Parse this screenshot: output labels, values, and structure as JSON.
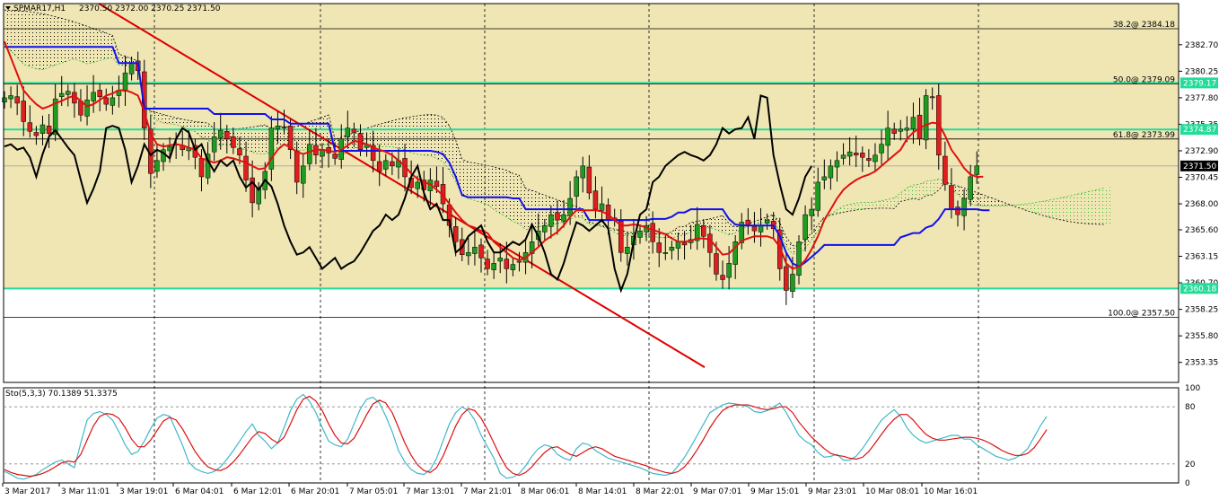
{
  "header": {
    "symbol": "SPMAR17,H1",
    "ohlc": "2370.50 2372.00 2370.25 2371.50"
  },
  "colors": {
    "background": "#ffffff",
    "band": "#efe6b4",
    "bull": "#1f9c1f",
    "bear": "#dd1f1f",
    "tenkan": "#e01010",
    "kijun": "#1010ee",
    "chikou": "#000000",
    "level_line": "#22dd99",
    "trend_line": "#dd0000",
    "sto_main": "#40b8c8",
    "sto_signal": "#dd1010"
  },
  "indicator": {
    "label": "Sto(5,3,3) 70.1389 51.3375"
  },
  "chart_data": [
    {
      "type": "candlestick",
      "title": "SPMAR17,H1",
      "ylim": [
        2351.5,
        2386.5
      ],
      "y_ticks": [
        "2382.70",
        "2380.25",
        "2377.80",
        "2375.35",
        "2372.90",
        "2370.45",
        "2368.00",
        "2365.60",
        "2363.15",
        "2360.70",
        "2358.25",
        "2355.80",
        "2353.35"
      ],
      "x_ticks": [
        "3 Mar 2017",
        "3 Mar 11:01",
        "3 Mar 19:01",
        "6 Mar 04:01",
        "6 Mar 12:01",
        "6 Mar 20:01",
        "7 Mar 05:01",
        "7 Mar 13:01",
        "7 Mar 21:01",
        "8 Mar 06:01",
        "8 Mar 14:01",
        "8 Mar 22:01",
        "9 Mar 07:01",
        "9 Mar 15:01",
        "9 Mar 23:01",
        "10 Mar 08:01",
        "10 Mar 16:01"
      ],
      "level_lines": [
        {
          "label": "2379.17",
          "value": 2379.17
        },
        {
          "label": "2374.87",
          "value": 2374.87
        },
        {
          "label": "2360.18",
          "value": 2360.18
        }
      ],
      "fibonacci": [
        {
          "label": "38.2@ 2384.18",
          "value": 2384.18
        },
        {
          "label": "50.0@ 2379.09",
          "value": 2379.09
        },
        {
          "label": "61.8@ 2373.99",
          "value": 2373.99
        },
        {
          "label": "100.0@ 2357.50",
          "value": 2357.5
        }
      ],
      "current_price": {
        "label": "2371.50",
        "value": 2371.5
      },
      "candles_close": [
        2377.8,
        2378.0,
        2377.3,
        2375.6,
        2374.7,
        2374.3,
        2375.3,
        2374.5,
        2377.7,
        2378.2,
        2378.4,
        2377.3,
        2376.2,
        2377.6,
        2378.3,
        2377.9,
        2377.2,
        2377.8,
        2378.5,
        2380.1,
        2381.0,
        2380.3,
        2375.0,
        2370.8,
        2372.0,
        2373.0,
        2373.3,
        2373.5,
        2373.0,
        2373.2,
        2372.3,
        2370.5,
        2372.6,
        2374.2,
        2374.8,
        2374.0,
        2373.2,
        2372.5,
        2370.2,
        2368.1,
        2369.4,
        2371.0,
        2375.0,
        2375.2,
        2375.0,
        2373.0,
        2370.0,
        2371.5,
        2373.5,
        2372.5,
        2373.0,
        2372.7,
        2372.2,
        2374.0,
        2375.0,
        2374.6,
        2373.0,
        2373.5,
        2372.0,
        2371.0,
        2372.0,
        2371.5,
        2372.0,
        2370.5,
        2369.5,
        2370.0,
        2369.3,
        2370.2,
        2369.6,
        2368.0,
        2366.0,
        2364.5,
        2363.3,
        2363.5,
        2364.0,
        2363.0,
        2362.0,
        2362.5,
        2363.0,
        2362.0,
        2362.4,
        2362.7,
        2363.5,
        2364.5,
        2365.5,
        2366.0,
        2367.0,
        2366.5,
        2367.0,
        2368.5,
        2370.5,
        2371.5,
        2369.0,
        2367.5,
        2368.0,
        2366.5,
        2366.5,
        2363.5,
        2364.0,
        2365.0,
        2365.5,
        2366.0,
        2364.5,
        2363.5,
        2363.5,
        2364.0,
        2364.5,
        2364.2,
        2364.7,
        2366.1,
        2365.0,
        2363.5,
        2361.5,
        2361.0,
        2362.5,
        2364.5,
        2366.3,
        2366.0,
        2365.5,
        2366.0,
        2366.5,
        2365.7,
        2362.0,
        2360.0,
        2361.5,
        2364.5,
        2367.0,
        2367.5,
        2370.0,
        2370.5,
        2371.5,
        2372.0,
        2372.5,
        2372.8,
        2372.5,
        2372.3,
        2372.0,
        2372.5,
        2373.5,
        2375.0,
        2374.5,
        2374.9,
        2375.0,
        2376.0,
        2374.0,
        2378.0,
        2377.8,
        2372.5,
        2369.8,
        2367.5,
        2367.0,
        2368.5,
        2370.5,
        2371.5
      ],
      "tenkan": [
        2383.0,
        2381.5,
        2380.0,
        2378.5,
        2377.8,
        2377.2,
        2376.8,
        2377.0,
        2377.3,
        2377.5,
        2377.8,
        2378.0,
        2377.5,
        2377.0,
        2377.2,
        2377.6,
        2378.0,
        2378.2,
        2378.5,
        2378.5,
        2378.3,
        2378.0,
        2376.5,
        2374.5,
        2373.5,
        2373.3,
        2373.4,
        2373.5,
        2373.4,
        2373.2,
        2373.0,
        2372.2,
        2372.0,
        2371.8,
        2372.0,
        2372.3,
        2372.2,
        2372.0,
        2371.8,
        2371.5,
        2371.2,
        2371.3,
        2372.2,
        2373.0,
        2373.5,
        2373.2,
        2372.8,
        2372.6,
        2372.8,
        2373.0,
        2373.0,
        2372.9,
        2372.8,
        2373.0,
        2373.4,
        2373.8,
        2373.7,
        2373.5,
        2373.2,
        2373.0,
        2372.8,
        2372.5,
        2372.0,
        2371.5,
        2370.8,
        2370.3,
        2370.0,
        2369.8,
        2369.3,
        2368.8,
        2368.0,
        2367.2,
        2366.5,
        2366.0,
        2365.8,
        2365.5,
        2365.3,
        2364.5,
        2364.0,
        2363.5,
        2363.0,
        2362.8,
        2363.0,
        2363.5,
        2364.0,
        2364.6,
        2365.0,
        2365.4,
        2366.0,
        2366.8,
        2367.4,
        2367.4,
        2367.4,
        2367.4,
        2367.3,
        2367.0,
        2366.5,
        2366.0,
        2366.0,
        2366.1,
        2366.0,
        2365.8,
        2365.6,
        2365.4,
        2365.2,
        2364.8,
        2364.5,
        2364.5,
        2364.6,
        2364.8,
        2364.8,
        2364.7,
        2364.0,
        2363.3,
        2363.4,
        2364.0,
        2364.6,
        2364.8,
        2365.0,
        2365.0,
        2365.0,
        2364.8,
        2364.0,
        2362.5,
        2362.0,
        2362.2,
        2362.8,
        2363.8,
        2365.0,
        2366.5,
        2367.5,
        2368.5,
        2369.3,
        2369.8,
        2370.2,
        2370.5,
        2370.7,
        2371.0,
        2371.5,
        2372.0,
        2372.5,
        2373.0,
        2374.0,
        2374.6,
        2375.0,
        2375.3,
        2375.5,
        2375.4,
        2374.3,
        2373.0,
        2372.2,
        2371.3,
        2370.7,
        2370.5,
        2370.5
      ],
      "kijun": [
        2382.5,
        2382.5,
        2382.5,
        2382.5,
        2382.5,
        2382.5,
        2382.5,
        2382.5,
        2382.5,
        2382.5,
        2382.5,
        2382.5,
        2382.5,
        2382.5,
        2382.5,
        2382.5,
        2382.5,
        2382.5,
        2381.0,
        2381.0,
        2381.0,
        2381.0,
        2376.8,
        2376.8,
        2376.8,
        2376.8,
        2376.8,
        2376.8,
        2376.8,
        2376.8,
        2376.8,
        2376.8,
        2376.8,
        2376.3,
        2376.3,
        2376.3,
        2376.3,
        2376.3,
        2376.3,
        2376.3,
        2376.3,
        2376.3,
        2375.8,
        2375.8,
        2375.8,
        2375.4,
        2375.4,
        2375.4,
        2375.4,
        2375.4,
        2375.4,
        2375.4,
        2372.9,
        2372.9,
        2372.9,
        2372.9,
        2372.9,
        2372.9,
        2372.9,
        2372.9,
        2372.9,
        2372.9,
        2372.9,
        2372.9,
        2372.9,
        2372.9,
        2372.9,
        2372.9,
        2372.8,
        2372.6,
        2371.8,
        2370.5,
        2368.8,
        2368.6,
        2368.6,
        2368.6,
        2368.6,
        2368.6,
        2368.6,
        2368.6,
        2368.5,
        2368.5,
        2367.5,
        2367.5,
        2367.5,
        2367.5,
        2367.5,
        2367.5,
        2367.5,
        2367.5,
        2367.5,
        2367.5,
        2366.5,
        2366.5,
        2366.5,
        2366.5,
        2366.5,
        2366.5,
        2366.5,
        2366.5,
        2366.5,
        2366.5,
        2366.6,
        2366.6,
        2366.6,
        2366.8,
        2367.2,
        2367.2,
        2367.5,
        2367.5,
        2367.5,
        2367.5,
        2367.5,
        2367.5,
        2366.6,
        2366.1,
        2366.0,
        2366.0,
        2366.0,
        2366.0,
        2366.0,
        2366.0,
        2365.0,
        2363.5,
        2362.5,
        2362.2,
        2362.6,
        2363.1,
        2363.6,
        2364.2,
        2364.2,
        2364.2,
        2364.2,
        2364.2,
        2364.2,
        2364.2,
        2364.2,
        2364.2,
        2364.2,
        2364.2,
        2364.2,
        2364.9,
        2365.1,
        2365.3,
        2365.3,
        2365.8,
        2366.0,
        2366.6,
        2367.5,
        2367.5,
        2367.5,
        2367.5,
        2367.5,
        2367.5,
        2367.4,
        2367.4
      ]
    },
    {
      "type": "line",
      "title": "Sto(5,3,3)",
      "ylim": [
        0,
        100
      ],
      "y_ticks": [
        "100",
        "80",
        "20",
        "0"
      ],
      "series": [
        {
          "name": "main",
          "values": [
            12,
            9,
            5,
            4,
            6,
            9,
            14,
            18,
            22,
            24,
            20,
            16,
            42,
            66,
            73,
            75,
            72,
            66,
            54,
            40,
            30,
            33,
            44,
            57,
            68,
            72,
            70,
            55,
            40,
            22,
            15,
            12,
            10,
            12,
            17,
            25,
            34,
            44,
            54,
            62,
            50,
            44,
            36,
            42,
            58,
            76,
            88,
            93,
            86,
            74,
            58,
            44,
            40,
            38,
            46,
            62,
            78,
            88,
            90,
            84,
            70,
            54,
            34,
            22,
            14,
            10,
            9,
            14,
            26,
            44,
            62,
            74,
            80,
            76,
            66,
            50,
            38,
            26,
            10,
            5,
            6,
            10,
            18,
            28,
            36,
            40,
            38,
            30,
            26,
            24,
            36,
            42,
            40,
            34,
            30,
            26,
            24,
            22,
            20,
            18,
            16,
            13,
            10,
            9,
            8,
            10,
            18,
            27,
            38,
            50,
            62,
            74,
            78,
            82,
            84,
            83,
            82,
            80,
            75,
            74,
            76,
            80,
            84,
            74,
            62,
            50,
            44,
            40,
            32,
            27,
            28,
            30,
            24,
            24,
            28,
            36,
            46,
            56,
            66,
            72,
            77,
            70,
            58,
            50,
            45,
            42,
            44,
            46,
            48,
            50,
            50,
            46,
            46,
            40,
            36,
            32,
            28,
            26,
            24,
            26,
            30,
            36,
            48,
            60,
            70
          ]
        },
        {
          "name": "signal",
          "values": [
            14,
            11,
            9,
            8,
            7,
            8,
            10,
            13,
            17,
            21,
            23,
            22,
            30,
            45,
            60,
            70,
            73,
            72,
            68,
            58,
            46,
            38,
            38,
            45,
            55,
            65,
            69,
            66,
            57,
            45,
            33,
            24,
            17,
            14,
            13,
            16,
            22,
            30,
            39,
            48,
            54,
            52,
            46,
            42,
            48,
            62,
            77,
            88,
            91,
            86,
            76,
            62,
            50,
            42,
            41,
            47,
            59,
            72,
            83,
            87,
            84,
            74,
            58,
            42,
            29,
            19,
            13,
            11,
            16,
            28,
            44,
            60,
            72,
            78,
            76,
            68,
            56,
            42,
            28,
            16,
            10,
            8,
            11,
            17,
            25,
            32,
            37,
            38,
            34,
            30,
            28,
            32,
            36,
            38,
            36,
            32,
            28,
            26,
            24,
            22,
            20,
            18,
            15,
            13,
            11,
            10,
            12,
            17,
            25,
            35,
            46,
            58,
            68,
            76,
            80,
            82,
            82,
            82,
            80,
            78,
            77,
            78,
            80,
            80,
            74,
            64,
            56,
            48,
            42,
            36,
            31,
            29,
            28,
            26,
            25,
            27,
            33,
            42,
            51,
            60,
            67,
            72,
            72,
            66,
            58,
            51,
            47,
            45,
            45,
            46,
            47,
            48,
            48,
            47,
            45,
            42,
            38,
            34,
            31,
            29,
            29,
            31,
            37,
            46,
            56
          ]
        }
      ]
    }
  ]
}
